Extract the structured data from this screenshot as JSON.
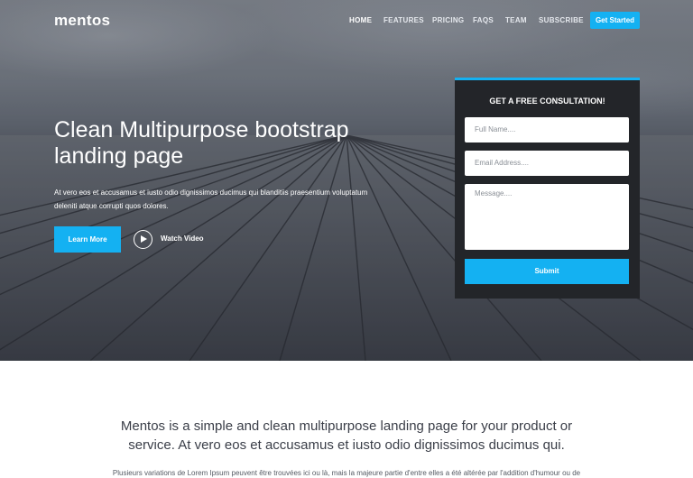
{
  "brand": {
    "logo": "mentos"
  },
  "nav": {
    "items": [
      {
        "label": "HOME",
        "active": true
      },
      {
        "label": "FEATURES"
      },
      {
        "label": "PRICING"
      },
      {
        "label": "FAQS"
      },
      {
        "label": "TEAM"
      },
      {
        "label": "SUBSCRIBE"
      }
    ],
    "cta": "Get Started"
  },
  "hero": {
    "title": "Clean Multipurpose bootstrap landing page",
    "description": "At vero eos et accusamus et iusto odio dignissimos ducimus qui blanditiis praesentium voluptatum deleniti atque corrupti quos dolores.",
    "learn_more": "Learn More",
    "watch_video": "Watch Video"
  },
  "form": {
    "title": "GET A FREE CONSULTATION!",
    "name_placeholder": "Full Name....",
    "email_placeholder": "Email Address....",
    "message_placeholder": "Message....",
    "submit": "Submit"
  },
  "section": {
    "intro": "Mentos is a simple and clean multipurpose landing page for your product or service. At vero eos et accusamus et iusto odio dignissimos ducimus qui.",
    "paragraph": "Plusieurs variations de Lorem Ipsum peuvent être trouvées ici ou là, mais la majeure partie d'entre elles a été altérée par l'addition d'humour ou de"
  },
  "colors": {
    "accent": "#14b1f2",
    "card_bg": "#232529",
    "heading_text": "#3a3e48"
  }
}
